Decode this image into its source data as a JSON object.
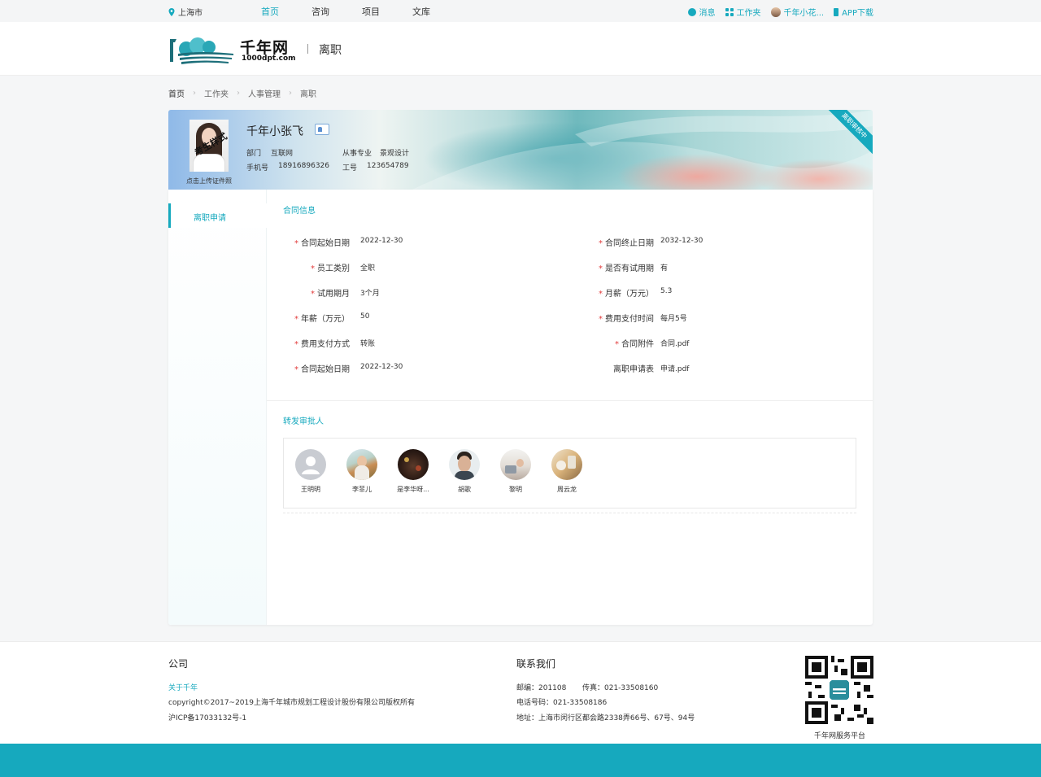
{
  "topbar": {
    "location": "上海市",
    "nav": [
      "首页",
      "咨询",
      "项目",
      "文库"
    ],
    "messages": "消息",
    "workspace": "工作夹",
    "user": "千年小花...",
    "app": "APP下载"
  },
  "header": {
    "brand": "千年网",
    "domain": "1000dpt.com",
    "page_name": "离职"
  },
  "breadcrumb": [
    "首页",
    "工作夹",
    "人事管理",
    "离职"
  ],
  "profile": {
    "name": "千年小张飞",
    "photo_caption": "点击上传证件照",
    "photo_stamp": "考生样式",
    "dept_label": "部门",
    "dept": "互联网",
    "major_label": "从事专业",
    "major": "景观设计",
    "phone_label": "手机号",
    "phone": "18916896326",
    "job_no_label": "工号",
    "job_no": "123654789",
    "status_ribbon": "离职审核中"
  },
  "sidebar": {
    "items": [
      {
        "label": "离职申请"
      }
    ]
  },
  "contract": {
    "title": "合同信息",
    "left": [
      {
        "label": "合同起始日期",
        "value": "2022-12-30",
        "required": "*"
      },
      {
        "label": "员工类别",
        "value": "全职",
        "required": "*"
      },
      {
        "label": "试用期月",
        "value": "3个月",
        "required": "*"
      },
      {
        "label": "年薪（万元）",
        "value": "50",
        "required": "*"
      },
      {
        "label": "费用支付方式",
        "value": "转账",
        "required": "*"
      },
      {
        "label": "合同起始日期",
        "value": "2022-12-30",
        "required": "*"
      }
    ],
    "right": [
      {
        "label": "合同终止日期",
        "value": "2032-12-30",
        "required": "*"
      },
      {
        "label": "是否有试用期",
        "value": "有",
        "required": "*"
      },
      {
        "label": "月薪（万元）",
        "value": "5.3",
        "required": "*"
      },
      {
        "label": "费用支付时间",
        "value": "每月5号",
        "required": "*"
      },
      {
        "label": "合同附件",
        "value": "合同.pdf",
        "required": "*"
      },
      {
        "label": "离职申请表",
        "value": "申请.pdf",
        "required": ""
      }
    ]
  },
  "approvers": {
    "title": "转发审批人",
    "people": [
      {
        "name": "王明明"
      },
      {
        "name": "李菲儿"
      },
      {
        "name": "是李华呀..."
      },
      {
        "name": "胡歌"
      },
      {
        "name": "黎明"
      },
      {
        "name": "周云龙"
      }
    ]
  },
  "footer": {
    "company_title": "公司",
    "about": "关于千年",
    "copyright": "copyright©2017~2019上海千年城市规划工程设计股份有限公司版权所有",
    "icp": "沪ICP备17033132号-1",
    "contact_title": "联系我们",
    "postcode": "邮编：201108",
    "fax": "传真：021-33508160",
    "phone": "电话号码：021-33508186",
    "address": "地址：上海市闵行区都会路2338弄66号、67号、94号",
    "qr_caption": "千年网服务平台"
  },
  "colors": {
    "accent": "#16a9be",
    "required": "#e23b3b"
  }
}
